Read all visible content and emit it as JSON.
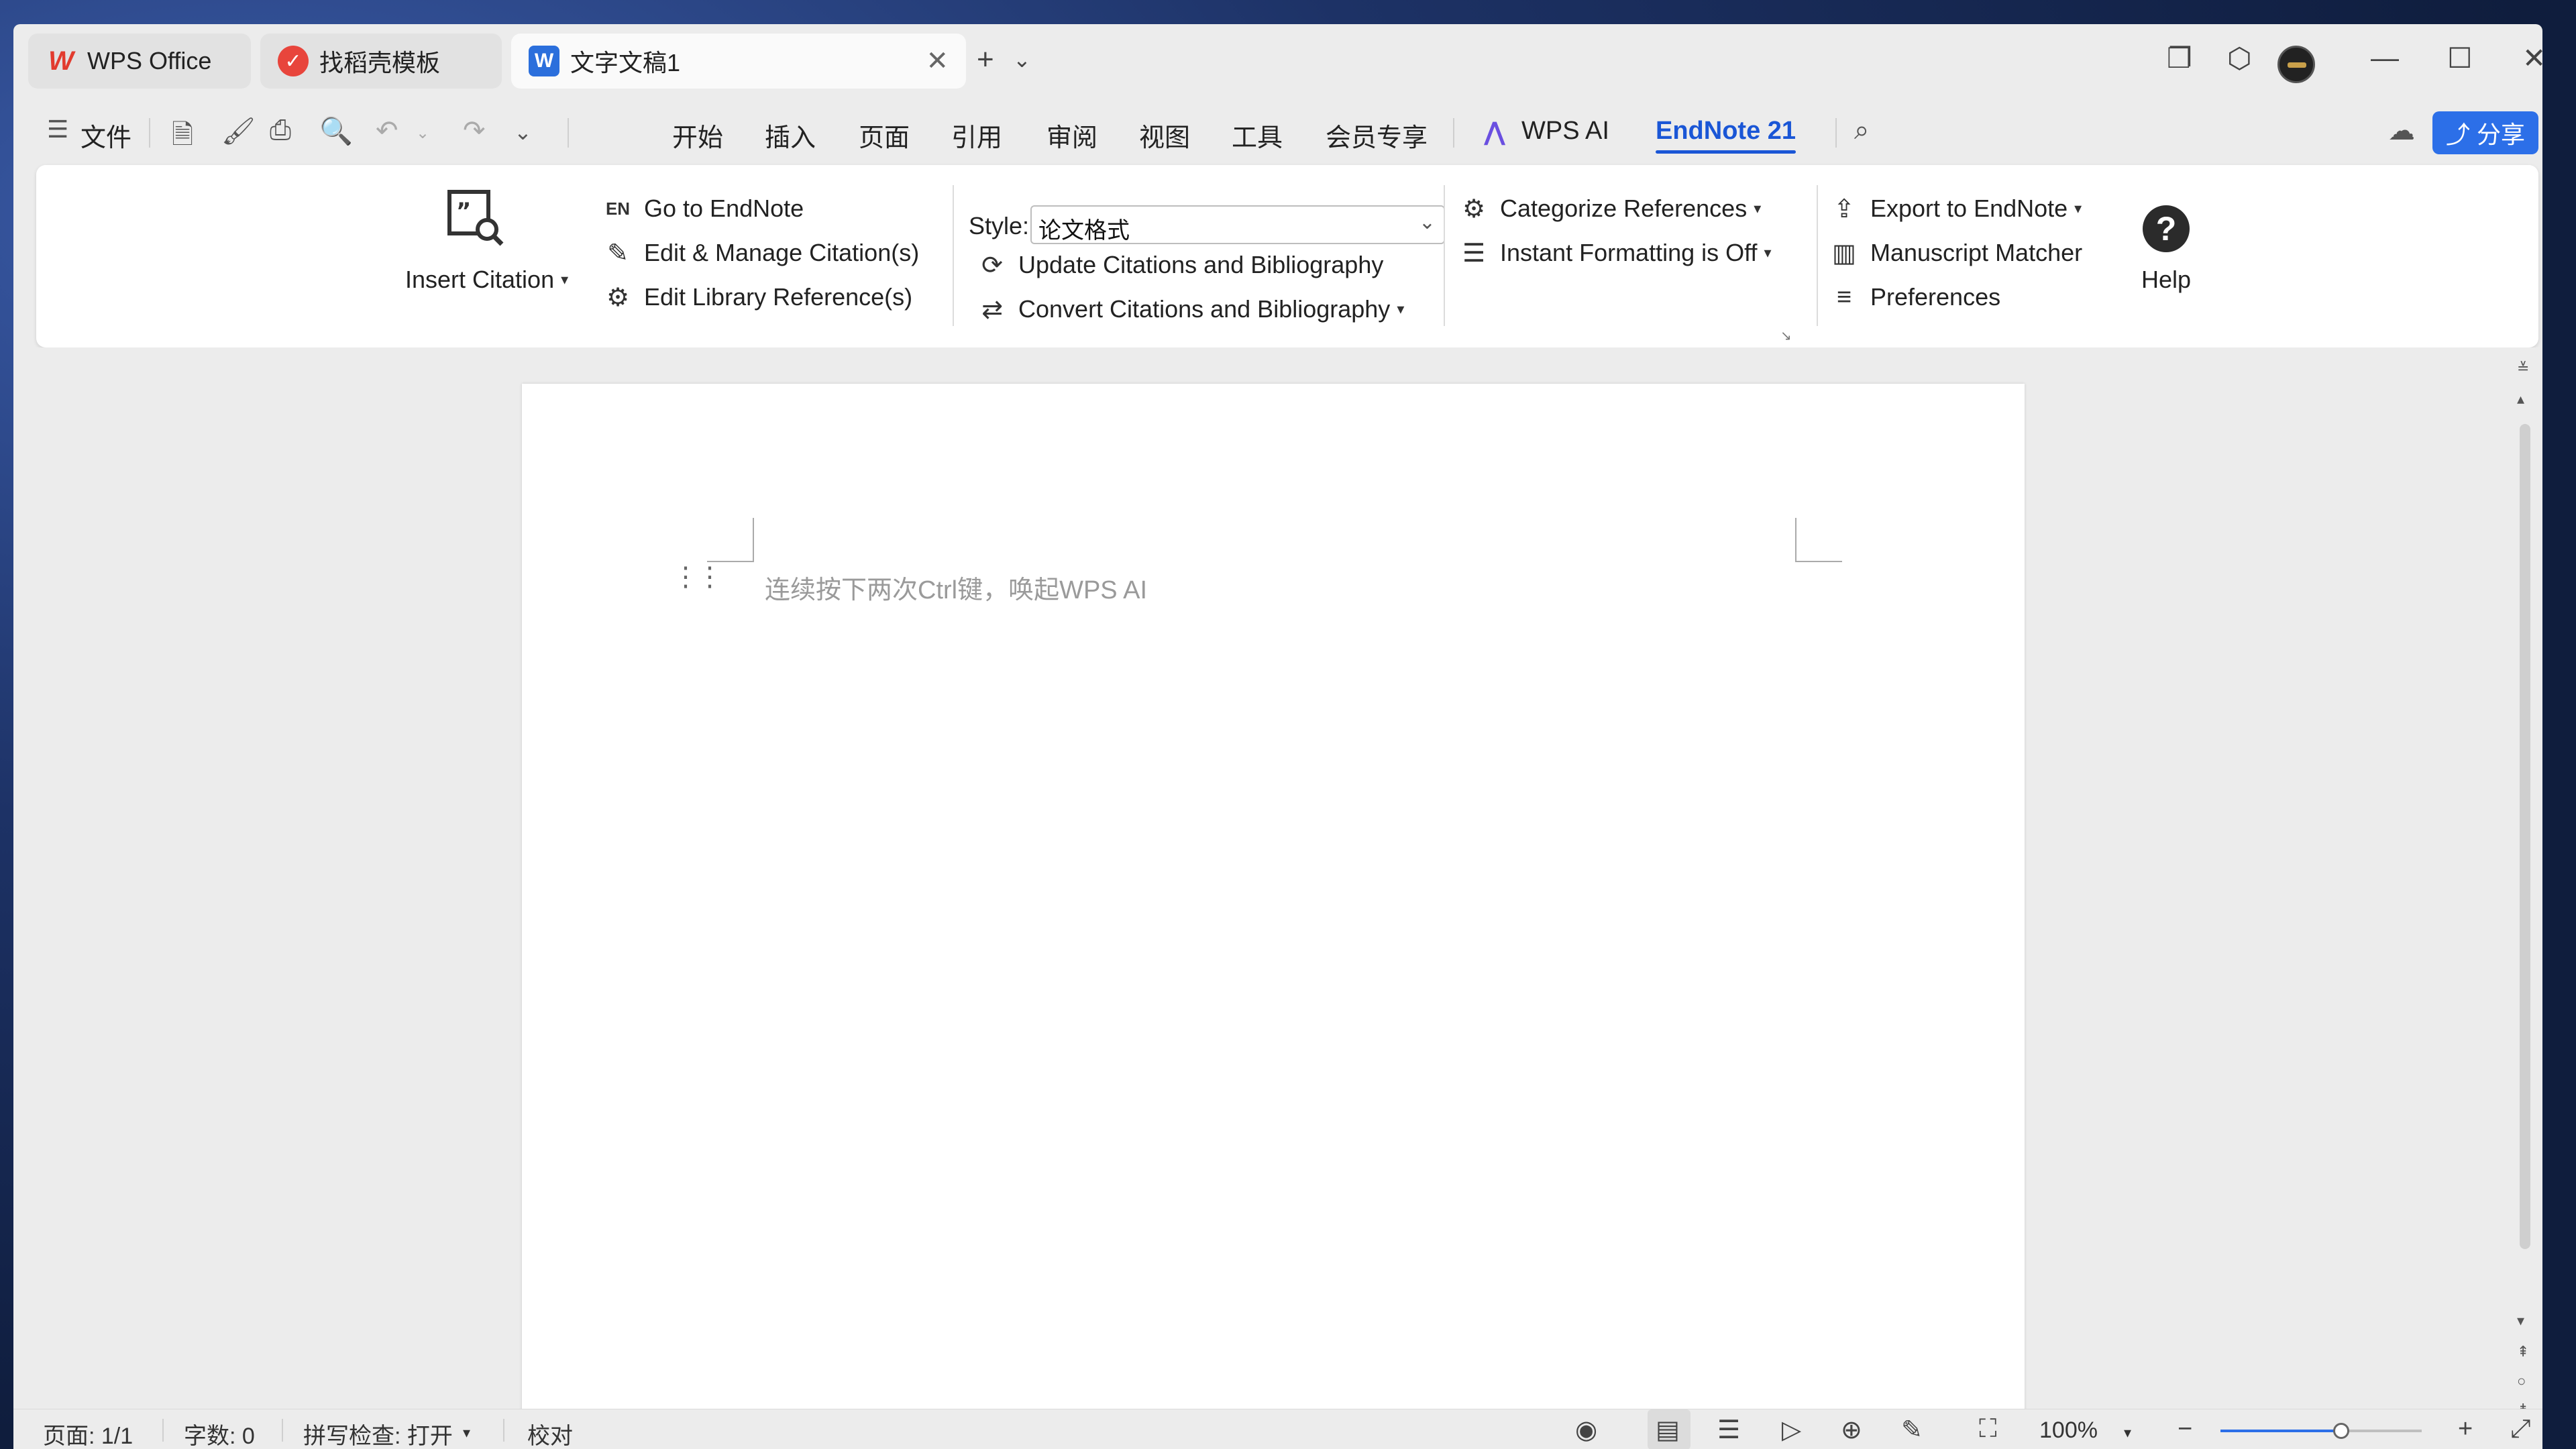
{
  "titlebar": {
    "tabs": [
      {
        "label": "WPS Office",
        "icon": "wps-logo-icon"
      },
      {
        "label": "找稻壳模板",
        "icon": "docer-icon"
      },
      {
        "label": "文字文稿1",
        "icon": "writer-doc-icon"
      }
    ],
    "new_tab_symbol": "+",
    "tab_list_symbol": "⌄"
  },
  "menubar": {
    "file_label": "文件",
    "tabs": [
      "开始",
      "插入",
      "页面",
      "引用",
      "审阅",
      "视图",
      "工具",
      "会员专享",
      "WPS AI",
      "EndNote 21"
    ],
    "active_tab": "EndNote 21",
    "share_label": "分享"
  },
  "ribbon": {
    "insert_citation": "Insert Citation",
    "go_to_endnote": "Go to EndNote",
    "en_badge": "EN",
    "edit_manage": "Edit & Manage Citation(s)",
    "edit_library": "Edit Library Reference(s)",
    "style_label": "Style:",
    "style_value": "论文格式",
    "update_citations": "Update Citations and Bibliography",
    "convert_citations": "Convert Citations and Bibliography",
    "categorize": "Categorize References",
    "instant_formatting": "Instant Formatting is Off",
    "export_to_endnote": "Export to EndNote",
    "manuscript_matcher": "Manuscript Matcher",
    "preferences": "Preferences",
    "help": "Help"
  },
  "document": {
    "placeholder": "连续按下两次Ctrl键，唤起WPS AI"
  },
  "statusbar": {
    "page": "页面: 1/1",
    "word_count": "字数: 0",
    "spell_check": "拼写检查: 打开",
    "proofread": "校对",
    "zoom": "100%",
    "zoom_fraction": 0.6
  },
  "colors": {
    "accent": "#2c6fe8",
    "active_tab": "#1a56d6",
    "wps_red": "#e23b2e"
  }
}
